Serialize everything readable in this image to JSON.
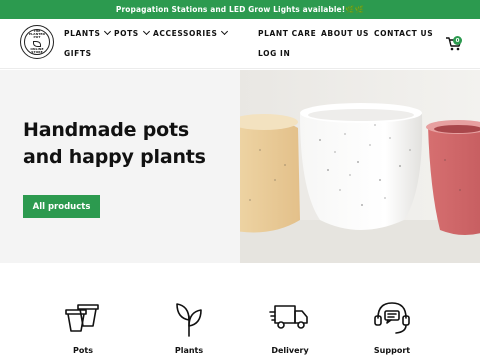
{
  "announcement": {
    "text": "Propagation Stations and LED Grow Lights available!🌿🌿"
  },
  "logo": {
    "alt": "The Planted Pot online store"
  },
  "nav": {
    "plants": "PLANTS",
    "pots": "POTS",
    "accessories": "ACCESSORIES",
    "gifts": "GIFTS",
    "plant_care": "PLANT CARE",
    "about_us": "ABOUT US",
    "contact_us": "CONTACT US",
    "log_in": "LOG IN"
  },
  "cart": {
    "count": "0"
  },
  "hero": {
    "title_line1": "Handmade pots",
    "title_line2": "and happy plants",
    "button_label": "All products"
  },
  "features": [
    {
      "label": "Pots",
      "icon": "pots-icon"
    },
    {
      "label": "Plants",
      "icon": "leaf-icon"
    },
    {
      "label": "Delivery",
      "icon": "truck-icon"
    },
    {
      "label": "Support",
      "icon": "headset-icon"
    }
  ],
  "colors": {
    "brand_green": "#2c9a4f",
    "hero_bg": "#f4f4f4"
  }
}
